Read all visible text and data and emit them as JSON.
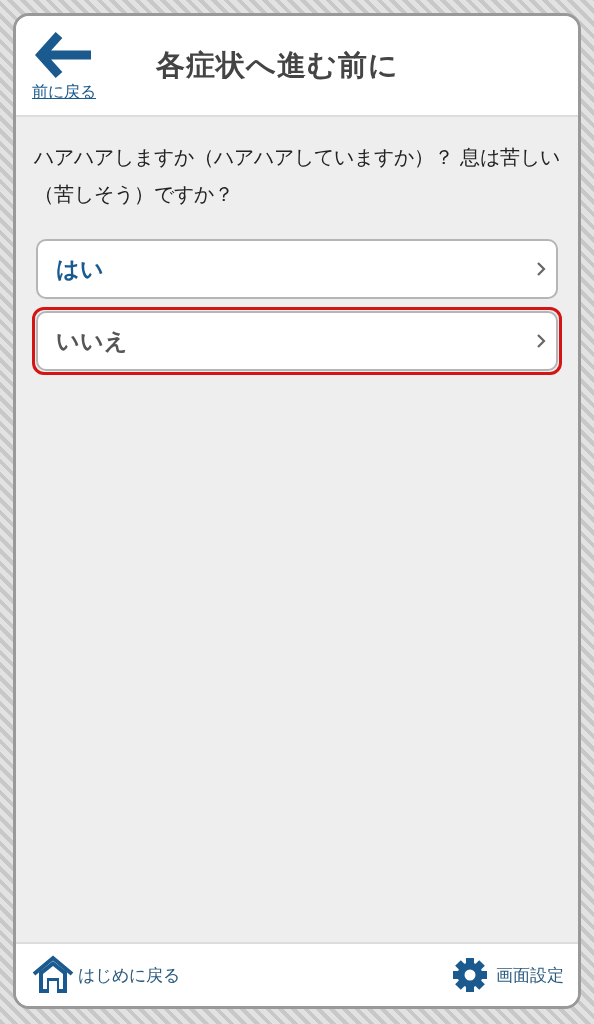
{
  "header": {
    "back_link": "前に戻る",
    "title": "各症状へ進む前に"
  },
  "question": "ハアハアしますか（ハアハアしていますか）？ 息は苦しい（苦しそう）ですか？",
  "answers": [
    {
      "label": "はい",
      "kind": "yes",
      "selected": false
    },
    {
      "label": "いいえ",
      "kind": "no",
      "selected": true
    }
  ],
  "footer": {
    "home": "はじめに戻る",
    "settings": "画面設定"
  }
}
